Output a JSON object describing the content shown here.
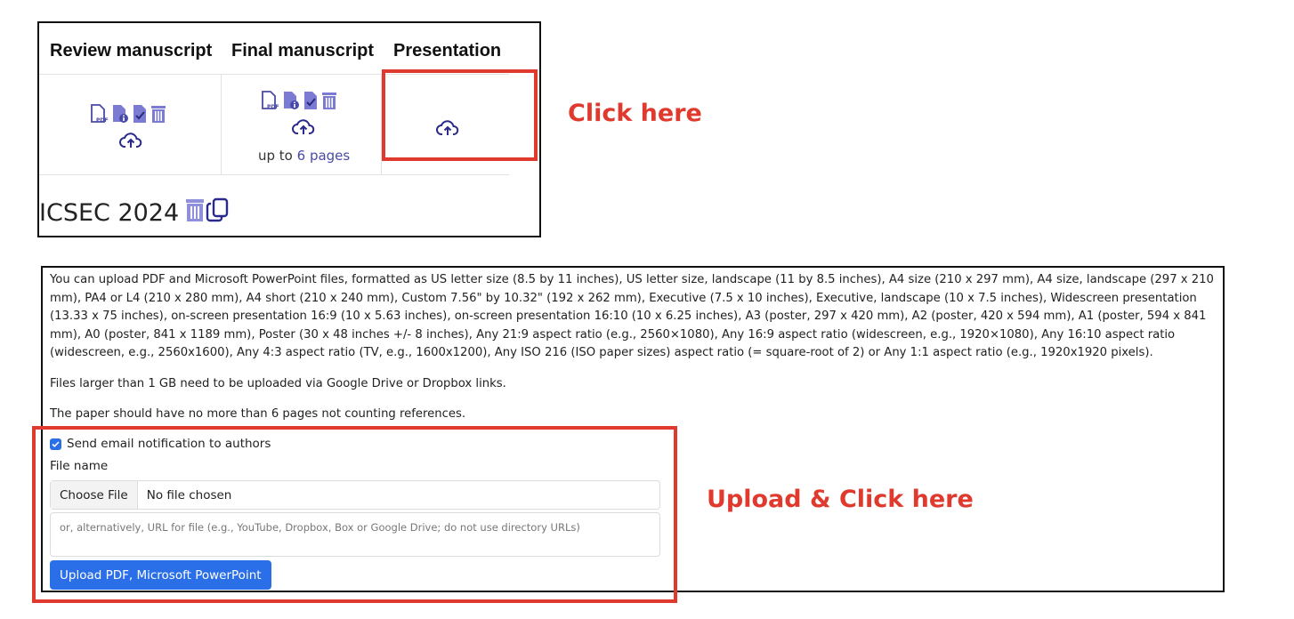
{
  "submission_table": {
    "columns": [
      "Review manuscript",
      "Final manuscript",
      "Presentation"
    ],
    "final_manuscript_note": {
      "prefix": "up to",
      "link": "6 pages"
    },
    "conference_title": "ICSEC 2024"
  },
  "annotations": {
    "click_here": "Click here",
    "upload_click_here": "Upload & Click here"
  },
  "upload_form": {
    "description": "You can upload PDF and Microsoft PowerPoint files, formatted as US letter size (8.5 by 11 inches), US letter size, landscape (11 by 8.5 inches), A4 size (210 x 297 mm), A4 size, landscape (297 x 210 mm), PA4 or L4 (210 x 280 mm), A4 short (210 x 240 mm), Custom 7.56\" by 10.32\" (192 x 262 mm), Executive (7.5 x 10 inches), Executive, landscape (10 x 7.5 inches), Widescreen presentation (13.33 x 75 inches), on-screen presentation 16:9 (10 x 5.63 inches), on-screen presentation 16:10 (10 x 6.25 inches), A3 (poster, 297 x 420 mm), A2 (poster, 420 x 594 mm), A1 (poster, 594 x 841 mm), A0 (poster, 841 x 1189 mm), Poster (30 x 48 inches +/- 8 inches), Any 21:9 aspect ratio (e.g., 2560×1080), Any 16:9 aspect ratio (widescreen, e.g., 1920×1080), Any 16:10 aspect ratio (widescreen, e.g., 2560x1600), Any 4:3 aspect ratio (TV, e.g., 1600x1200), Any ISO 216 (ISO paper sizes) aspect ratio (= square-root of 2) or Any 1:1 aspect ratio (e.g., 1920x1920 pixels).",
    "large_files_note": "Files larger than 1 GB need to be uploaded via Google Drive or Dropbox links.",
    "page_limit_note": "The paper should have no more than 6 pages not counting references.",
    "notify_label": "Send email notification to authors",
    "notify_checked": true,
    "file_name_label": "File name",
    "choose_file_label": "Choose File",
    "no_file_text": "No file chosen",
    "url_placeholder": "or, alternatively, URL for file (e.g., YouTube, Dropbox, Box or Google Drive; do not use directory URLs)",
    "upload_button_label": "Upload PDF, Microsoft PowerPoint"
  },
  "colors": {
    "accent_blue": "#2a6fe8",
    "icon_purple": "#7b7bd4",
    "annotation_red": "#e03a2e"
  }
}
